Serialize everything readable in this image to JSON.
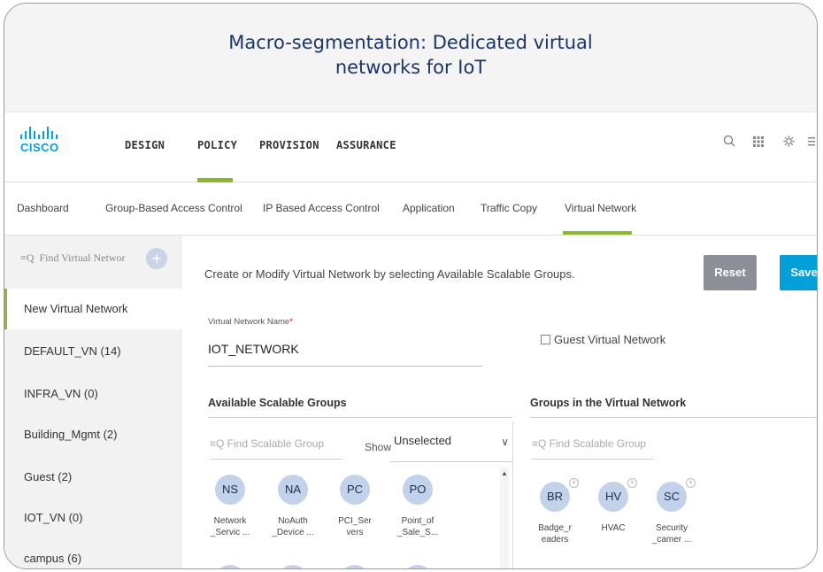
{
  "slide": {
    "title_line1": "Macro-segmentation: Dedicated virtual",
    "title_line2": "networks for IoT"
  },
  "topnav": {
    "logo_text": "CISCO",
    "items": [
      "DESIGN",
      "POLICY",
      "PROVISION",
      "ASSURANCE"
    ],
    "active": "POLICY",
    "icons": [
      "search-icon",
      "apps-grid-icon",
      "gear-icon",
      "menu-icon"
    ]
  },
  "subnav": {
    "items": [
      "Dashboard",
      "Group-Based Access Control",
      "IP Based Access Control",
      "Application",
      "Traffic Copy",
      "Virtual Network"
    ],
    "active": "Virtual Network"
  },
  "sidebar": {
    "search_placeholder": "Find Virtual Networ",
    "add_icon": "plus-icon",
    "items": [
      "New Virtual Network",
      "DEFAULT_VN  (14)",
      "INFRA_VN  (0)",
      "Building_Mgmt  (2)",
      "Guest  (2)",
      "IOT_VN  (0)",
      "campus  (6)"
    ],
    "active": "New Virtual Network"
  },
  "main": {
    "instruction": "Create or Modify Virtual Network by selecting Available Scalable Groups.",
    "reset_label": "Reset",
    "save_label": "Save",
    "vn_name_label": "Virtual Network Name",
    "vn_name_required": "*",
    "vn_name_value": "IOT_NETWORK",
    "guest_label": "Guest Virtual Network",
    "guest_checked": false
  },
  "available": {
    "title": "Available Scalable Groups",
    "search_placeholder": "Find Scalable Group",
    "show_label": "Show",
    "show_value": "Unselected",
    "groups": [
      {
        "abbr": "NS",
        "line1": "Network",
        "line2": "_Servic ..."
      },
      {
        "abbr": "NA",
        "line1": "NoAuth",
        "line2": "_Device ..."
      },
      {
        "abbr": "PC",
        "line1": "PCI_Ser",
        "line2": "vers"
      },
      {
        "abbr": "PO",
        "line1": "Point_of",
        "line2": "_Sale_S..."
      }
    ]
  },
  "selected": {
    "title": "Groups in the Virtual Network",
    "search_placeholder": "Find Scalable Group",
    "groups": [
      {
        "abbr": "BR",
        "line1": "Badge_r",
        "line2": "eaders"
      },
      {
        "abbr": "HV",
        "line1": "HVAC",
        "line2": ""
      },
      {
        "abbr": "SC",
        "line1": "Security",
        "line2": "_camer ..."
      }
    ]
  },
  "colors": {
    "accent_green": "#8ab92d",
    "save_blue": "#049fd9",
    "reset_gray": "#8c8f95",
    "bubble_blue": "#c2d2ea",
    "title_navy": "#1d3566"
  }
}
